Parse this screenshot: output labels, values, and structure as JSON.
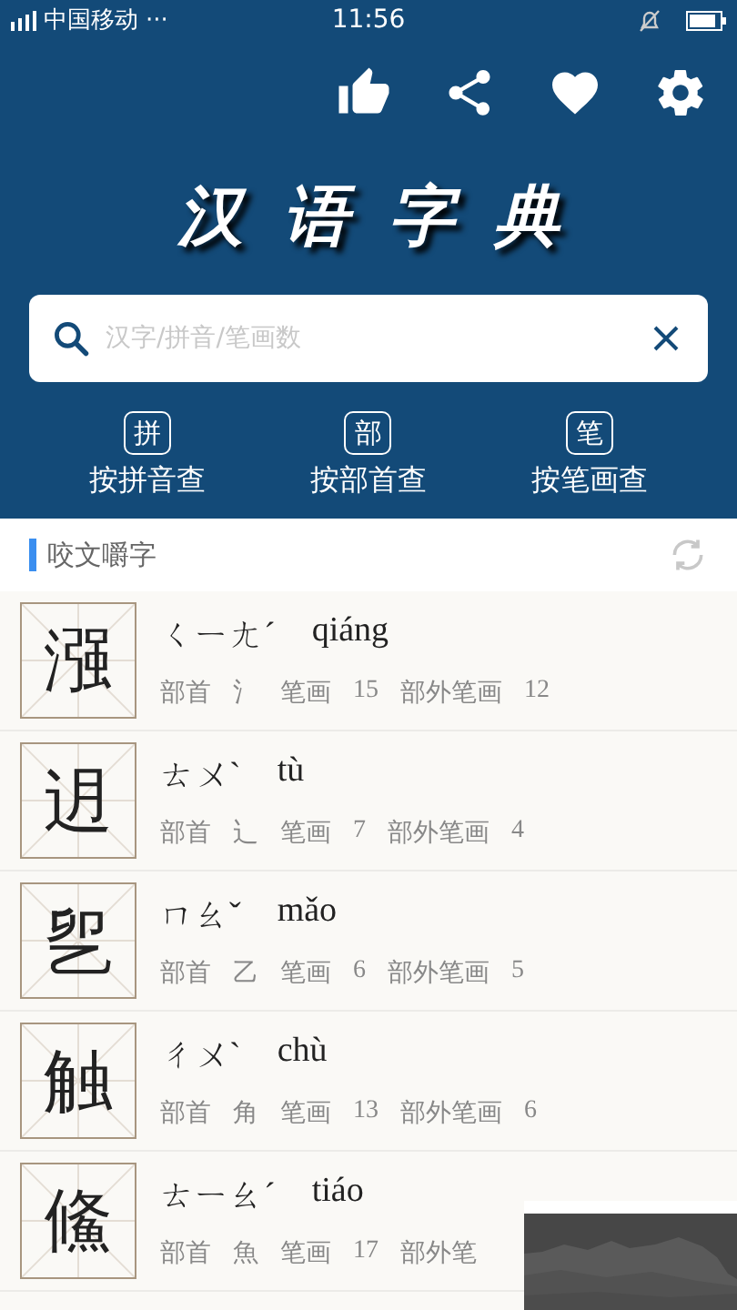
{
  "status_bar": {
    "carrier": "中国移动",
    "more": "···",
    "time": "11:56"
  },
  "title": "汉语字典",
  "search": {
    "placeholder": "汉字/拼音/笔画数"
  },
  "lookups": [
    {
      "key": "拼",
      "label": "按拼音查"
    },
    {
      "key": "部",
      "label": "按部首查"
    },
    {
      "key": "笔",
      "label": "按笔画查"
    }
  ],
  "section": {
    "title": "咬文嚼字"
  },
  "characters": [
    {
      "character": "漒",
      "zhuyin": "ㄑㄧㄤˊ",
      "pinyin": "qiáng",
      "radical_label": "部首",
      "radical": "氵",
      "strokes_label": "笔画",
      "strokes": "15",
      "extra_label": "部外笔画",
      "extra": "12"
    },
    {
      "character": "迌",
      "zhuyin": "ㄊㄨˋ",
      "pinyin": "tù",
      "radical_label": "部首",
      "radical": "辶",
      "strokes_label": "笔画",
      "strokes": "7",
      "extra_label": "部外笔画",
      "extra": "4"
    },
    {
      "character": "乮",
      "zhuyin": "ㄇㄠˇ",
      "pinyin": "mǎo",
      "radical_label": "部首",
      "radical": "乙",
      "strokes_label": "笔画",
      "strokes": "6",
      "extra_label": "部外笔画",
      "extra": "5"
    },
    {
      "character": "触",
      "zhuyin": "ㄔㄨˋ",
      "pinyin": "chù",
      "radical_label": "部首",
      "radical": "角",
      "strokes_label": "笔画",
      "strokes": "13",
      "extra_label": "部外笔画",
      "extra": "6"
    },
    {
      "character": "鯈",
      "zhuyin": "ㄊㄧㄠˊ",
      "pinyin": "tiáo",
      "radical_label": "部首",
      "radical": "魚",
      "strokes_label": "笔画",
      "strokes": "17",
      "extra_label": "部外笔"
    }
  ]
}
